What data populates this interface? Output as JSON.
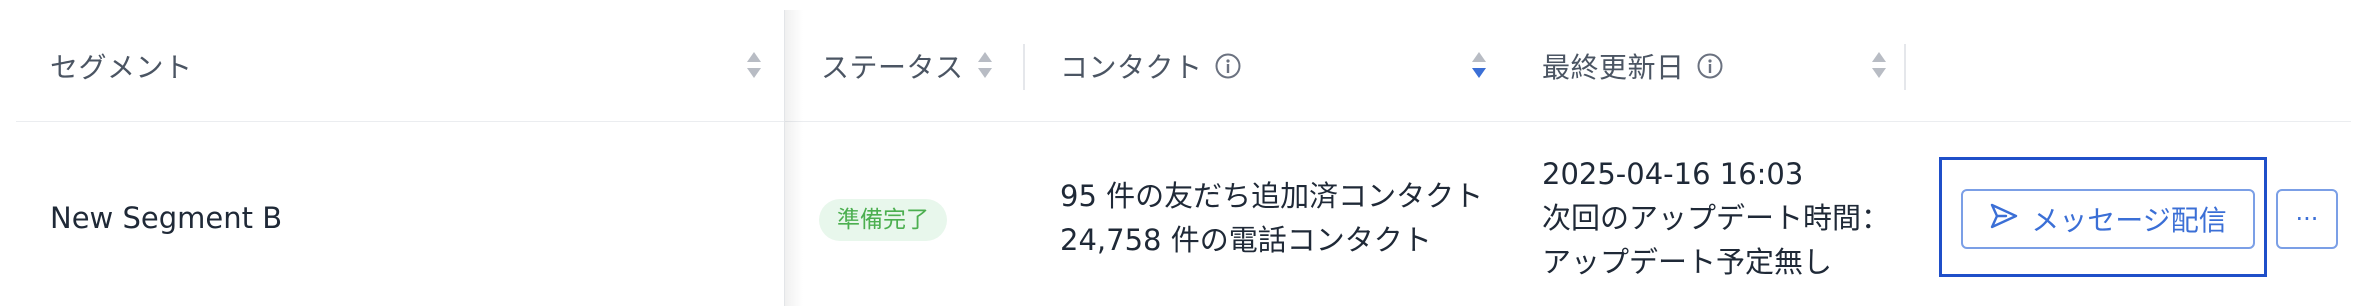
{
  "table": {
    "headers": {
      "segment": "セグメント",
      "status": "ステータス",
      "contacts": "コンタクト",
      "last_updated": "最終更新日"
    },
    "rows": [
      {
        "segment": "New Segment B",
        "status": "準備完了",
        "contacts_line1": "95 件の友だち追加済コンタクト",
        "contacts_line2": "24,758 件の電話コンタクト",
        "updated_date": "2025-04-16 16:03",
        "next_update_label": "次回のアップデート時間：",
        "next_update_value": "アップデート予定無し",
        "send_button": "メッセージ配信",
        "more_button": "···"
      }
    ]
  },
  "colors": {
    "accent": "#3b6fd6",
    "status_green": "#4caf50",
    "status_bg": "#e8f7ec",
    "sort_active": "#3b6fd6",
    "sort_inactive": "#b8bcc4",
    "highlight_border": "#1f4fc9"
  },
  "icons": {
    "sort": "sort-icon",
    "info": "info-icon",
    "send": "send-icon"
  }
}
